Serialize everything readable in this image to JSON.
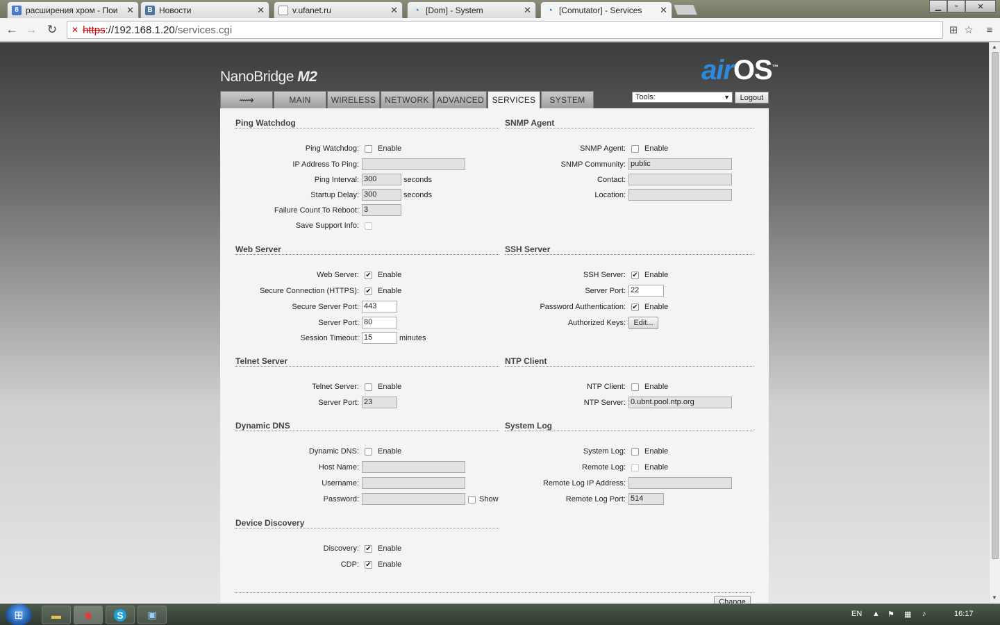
{
  "browser": {
    "tabs": [
      {
        "icon": "8",
        "icon_color": "#4a7bd0",
        "label": "расширения хром - Пои"
      },
      {
        "icon": "B",
        "icon_color": "#4c75a3",
        "label": "Новости"
      },
      {
        "icon": "",
        "icon_color": "#888888",
        "label": "v.ufanet.ru"
      },
      {
        "icon": "",
        "icon_color": "#3a7ac8",
        "label": "[Dom] - System"
      },
      {
        "icon": "",
        "icon_color": "#3a7ac8",
        "label": "[Comutator] - Services"
      }
    ],
    "url": {
      "scheme": "https",
      "host": "://192.168.1.20",
      "path": "/services.cgi"
    }
  },
  "header": {
    "brand_text": "NanoBridge",
    "brand_model": "M2",
    "logo_air": "air",
    "logo_os": "OS",
    "logo_tm": "™",
    "tools_label": "Tools:",
    "logout_label": "Logout"
  },
  "nav": {
    "tabs": [
      "MAIN",
      "WIRELESS",
      "NETWORK",
      "ADVANCED",
      "SERVICES",
      "SYSTEM"
    ],
    "active": "SERVICES"
  },
  "common": {
    "enable": "Enable",
    "seconds": "seconds",
    "minutes": "minutes",
    "show": "Show"
  },
  "ping_watchdog": {
    "title": "Ping Watchdog",
    "labels": {
      "watchdog": "Ping Watchdog:",
      "ip": "IP Address To Ping:",
      "interval": "Ping Interval:",
      "delay": "Startup Delay:",
      "failure": "Failure Count To Reboot:",
      "support": "Save Support Info:"
    },
    "values": {
      "enabled": false,
      "ip": "",
      "interval": "300",
      "delay": "300",
      "failure": "3",
      "support": false
    }
  },
  "snmp": {
    "title": "SNMP Agent",
    "labels": {
      "agent": "SNMP Agent:",
      "community": "SNMP Community:",
      "contact": "Contact:",
      "location": "Location:"
    },
    "values": {
      "enabled": false,
      "community": "public",
      "contact": "",
      "location": ""
    }
  },
  "web_server": {
    "title": "Web Server",
    "labels": {
      "server": "Web Server:",
      "https": "Secure Connection (HTTPS):",
      "secure_port": "Secure Server Port:",
      "port": "Server Port:",
      "timeout": "Session Timeout:"
    },
    "values": {
      "enabled": true,
      "https": true,
      "secure_port": "443",
      "port": "80",
      "timeout": "15"
    }
  },
  "ssh_server": {
    "title": "SSH Server",
    "labels": {
      "server": "SSH Server:",
      "port": "Server Port:",
      "password_auth": "Password Authentication:",
      "keys": "Authorized Keys:"
    },
    "values": {
      "enabled": true,
      "port": "22",
      "password_auth": true
    },
    "edit_label": "Edit..."
  },
  "telnet_server": {
    "title": "Telnet Server",
    "labels": {
      "server": "Telnet Server:",
      "port": "Server Port:"
    },
    "values": {
      "enabled": false,
      "port": "23"
    }
  },
  "ntp_client": {
    "title": "NTP Client",
    "labels": {
      "client": "NTP Client:",
      "server": "NTP Server:"
    },
    "values": {
      "enabled": false,
      "server": "0.ubnt.pool.ntp.org"
    }
  },
  "dynamic_dns": {
    "title": "Dynamic DNS",
    "labels": {
      "ddns": "Dynamic DNS:",
      "host": "Host Name:",
      "username": "Username:",
      "password": "Password:"
    },
    "values": {
      "enabled": false,
      "host": "",
      "username": "",
      "password": "",
      "show": false
    }
  },
  "system_log": {
    "title": "System Log",
    "labels": {
      "log": "System Log:",
      "remote": "Remote Log:",
      "remote_ip": "Remote Log IP Address:",
      "remote_port": "Remote Log Port:"
    },
    "values": {
      "enabled": false,
      "remote": false,
      "remote_ip": "",
      "remote_port": "514"
    }
  },
  "device_discovery": {
    "title": "Device Discovery",
    "labels": {
      "discovery": "Discovery:",
      "cdp": "CDP:"
    },
    "values": {
      "discovery": true,
      "cdp": true
    }
  },
  "change_label": "Change",
  "taskbar": {
    "lang": "EN",
    "time": "16:17"
  }
}
